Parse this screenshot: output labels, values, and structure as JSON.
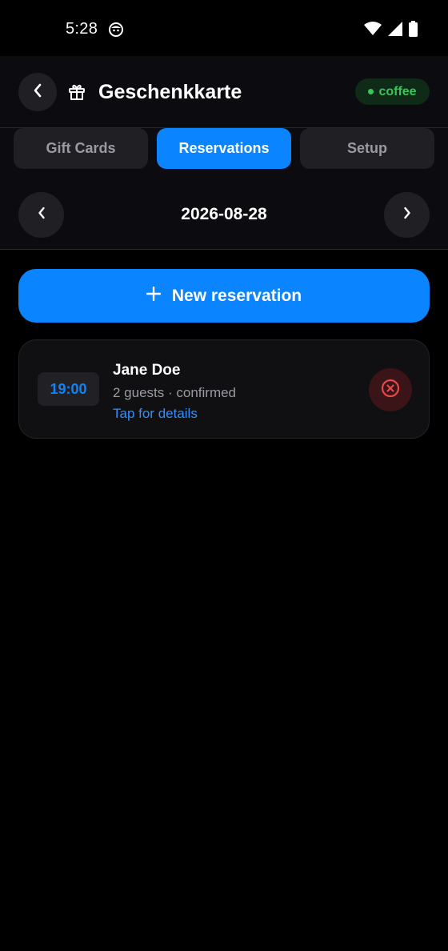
{
  "status_bar": {
    "time": "5:28",
    "icons": [
      "app-notification-icon",
      "wifi-icon",
      "cellular-signal-icon",
      "battery-icon"
    ]
  },
  "header": {
    "back_icon": "chevron-left-icon",
    "title_icon": "gift-icon",
    "title": "Geschenkkarte",
    "badge": {
      "label": "coffee",
      "color": "#35c75a"
    }
  },
  "tabs": [
    {
      "label": "Gift Cards",
      "active": false
    },
    {
      "label": "Reservations",
      "active": true
    },
    {
      "label": "Setup",
      "active": false
    }
  ],
  "date_nav": {
    "prev_icon": "chevron-left-icon",
    "date": "2026-08-28",
    "next_icon": "chevron-right-icon"
  },
  "new_reservation": {
    "icon": "plus-icon",
    "label": "New reservation"
  },
  "reservations": [
    {
      "time": "19:00",
      "name": "Jane Doe",
      "meta": "2 guests · confirmed",
      "link": "Tap for details",
      "cancel_icon": "cancel-circle-icon"
    }
  ],
  "colors": {
    "accent": "#0a84ff",
    "background": "#000000",
    "surface": "#0c0c10",
    "badge_green": "#35c75a",
    "danger": "#e5484d"
  }
}
